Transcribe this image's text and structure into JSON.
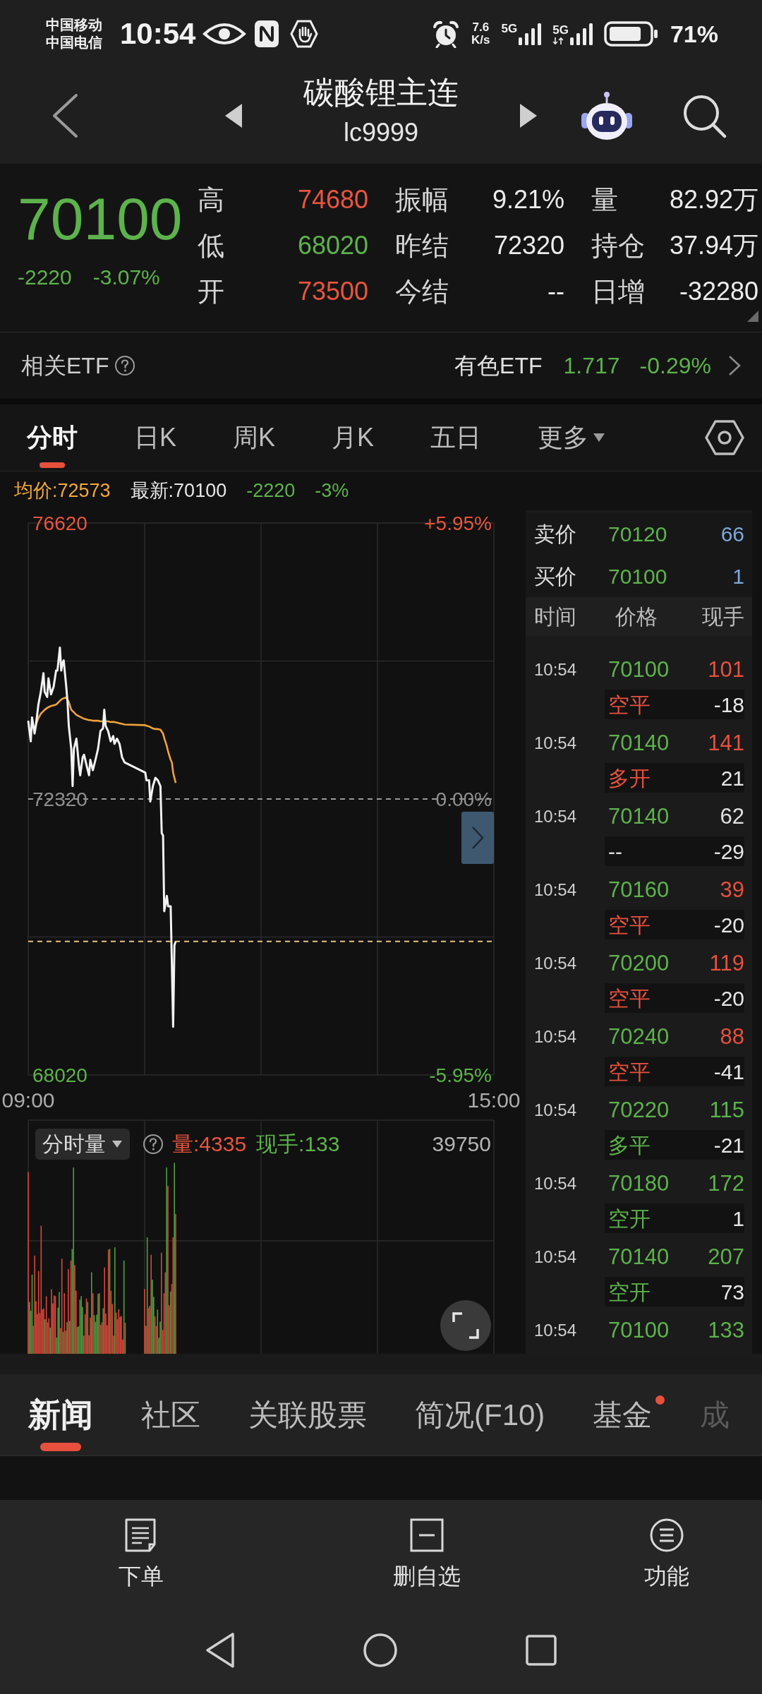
{
  "status_bar": {
    "carriers": [
      "中国移动",
      "中国电信"
    ],
    "time": "10:54",
    "speed": {
      "value": "7.6",
      "unit": "K/s"
    },
    "networks": [
      {
        "label": "5G",
        "kind": "plain"
      },
      {
        "label": "5G",
        "kind": "data"
      }
    ],
    "battery_text": "71%"
  },
  "header": {
    "title": "碳酸锂主连",
    "code": "lc9999"
  },
  "quote": {
    "price": "70100",
    "change": "-2220",
    "change_pct": "-3.07%",
    "stats": [
      {
        "label": "高",
        "value": "74680",
        "color": "#e8553f"
      },
      {
        "label": "振幅",
        "value": "9.21%"
      },
      {
        "label": "量",
        "value": "82.92万"
      },
      {
        "label": "低",
        "value": "68020",
        "color": "#5db24c"
      },
      {
        "label": "昨结",
        "value": "72320"
      },
      {
        "label": "持仓",
        "value": "37.94万"
      },
      {
        "label": "开",
        "value": "73500",
        "color": "#e8553f"
      },
      {
        "label": "今结",
        "value": "--"
      },
      {
        "label": "日增",
        "value": "-32280"
      }
    ]
  },
  "related_etf": {
    "label": "相关ETF",
    "name": "有色ETF",
    "price": "1.717",
    "change_pct": "-0.29%"
  },
  "chart_tabs": [
    {
      "label": "分时",
      "selected": true,
      "kind": "tab"
    },
    {
      "label": "日K",
      "selected": false,
      "kind": "tab"
    },
    {
      "label": "周K",
      "selected": false,
      "kind": "tab"
    },
    {
      "label": "月K",
      "selected": false,
      "kind": "tab"
    },
    {
      "label": "五日",
      "selected": false,
      "kind": "tab"
    },
    {
      "label": "更多",
      "selected": false,
      "kind": "menu"
    }
  ],
  "summary": {
    "average": "均价:72573",
    "latest": "最新:70100",
    "change": "-2220",
    "change_pct": "-3%"
  },
  "price_chart": {
    "chart_data": {
      "type": "line",
      "x": [
        9.0,
        9.033,
        9.049,
        9.082,
        9.098,
        9.131,
        9.163,
        9.196,
        9.212,
        9.245,
        9.261,
        9.294,
        9.327,
        9.359,
        9.376,
        9.408,
        9.425,
        9.441,
        9.457,
        9.49,
        9.506,
        9.523,
        9.555,
        9.572,
        9.588,
        9.621,
        9.653,
        9.67,
        9.702,
        9.719,
        9.751,
        9.784,
        9.8,
        9.833,
        9.866,
        9.899,
        9.931,
        9.964,
        9.98,
        9.997,
        10.029,
        10.062,
        10.095,
        10.111,
        10.144,
        10.176,
        10.209,
        10.242,
        10.508,
        10.524,
        10.557,
        10.573,
        10.606,
        10.639,
        10.671,
        10.704,
        10.72,
        10.737,
        10.753,
        10.786,
        10.802,
        10.835,
        10.851,
        10.867,
        10.884,
        10.9
      ],
      "series": [
        {
          "color": "#f2f2f2",
          "values": [
            73540,
            73220,
            73590,
            73340,
            73460,
            73790,
            73990,
            74280,
            73990,
            73910,
            74200,
            73950,
            74070,
            74320,
            74320,
            74680,
            74320,
            74440,
            74480,
            74070,
            73830,
            73460,
            73100,
            72520,
            73100,
            73260,
            72850,
            72690,
            72970,
            73010,
            72850,
            72690,
            72930,
            72770,
            72930,
            73100,
            73380,
            73420,
            73710,
            73460,
            73380,
            73220,
            73300,
            73180,
            73260,
            73180,
            72970,
            72890,
            72730,
            72610,
            72610,
            72280,
            72520,
            72650,
            72610,
            72520,
            71790,
            71750,
            70570,
            70810,
            70650,
            70650,
            69750,
            68770,
            70040,
            70100
          ]
        },
        {
          "color": "#f0a33a",
          "values": [
            null,
            null,
            null,
            73420,
            73470,
            73580,
            73650,
            73690,
            73710,
            73740,
            73750,
            73770,
            73780,
            73790,
            73810,
            73850,
            73870,
            73880,
            73890,
            73900,
            73870,
            73830,
            73710,
            73690,
            73670,
            73630,
            73610,
            73600,
            73580,
            73570,
            73560,
            73550,
            73550,
            73540,
            73540,
            73540,
            73530,
            73530,
            73530,
            73530,
            73530,
            73520,
            73520,
            73520,
            73510,
            73500,
            73490,
            73480,
            73470,
            73460,
            73450,
            73440,
            73420,
            73410,
            73410,
            73400,
            73370,
            73340,
            73270,
            73140,
            73060,
            72930,
            72890,
            72730,
            72650,
            72570
          ]
        }
      ],
      "xlim": [
        9,
        15
      ],
      "ylim": [
        68020,
        76620
      ],
      "xticks": [
        {
          "value": 9,
          "label": "09:00"
        },
        {
          "value": 15,
          "label": "15:00"
        }
      ],
      "yticks": [
        {
          "value": 76620,
          "label": "76620"
        },
        {
          "value": 72320,
          "label": "72320"
        },
        {
          "value": 68020,
          "label": "68020"
        }
      ],
      "ref_lines": [
        {
          "axis": "y",
          "value": 70100
        }
      ]
    },
    "right_labels": [
      "+5.95%",
      "0.00%",
      "-5.95%"
    ]
  },
  "volume_chart": {
    "selector": "分时量",
    "volume": "量:4335",
    "last_volume": "现手:133",
    "max": "39750"
  },
  "order_book": [
    {
      "label": "卖价",
      "price": "70120",
      "volume": "66"
    },
    {
      "label": "买价",
      "price": "70100",
      "volume": "1"
    }
  ],
  "trades": {
    "columns": [
      "时间",
      "价格",
      "现手"
    ],
    "rows": [
      {
        "time": "10:54",
        "price": "70100",
        "volume": "101",
        "type": "空平",
        "change": "-18",
        "color": "#e8503e"
      },
      {
        "time": "10:54",
        "price": "70140",
        "volume": "141",
        "type": "多开",
        "change": "21",
        "color": "#e8503e"
      },
      {
        "time": "10:54",
        "price": "70140",
        "volume": "62",
        "type": "--",
        "change": "-29",
        "color": "#e0e0e0"
      },
      {
        "time": "10:54",
        "price": "70160",
        "volume": "39",
        "type": "空平",
        "change": "-20",
        "color": "#e8503e"
      },
      {
        "time": "10:54",
        "price": "70200",
        "volume": "119",
        "type": "空平",
        "change": "-20",
        "color": "#e8503e"
      },
      {
        "time": "10:54",
        "price": "70240",
        "volume": "88",
        "type": "空平",
        "change": "-41",
        "color": "#e8503e"
      },
      {
        "time": "10:54",
        "price": "70220",
        "volume": "115",
        "type": "多平",
        "change": "-21",
        "color": "#5cb24a"
      },
      {
        "time": "10:54",
        "price": "70180",
        "volume": "172",
        "type": "空开",
        "change": "1",
        "color": "#5cb24a"
      },
      {
        "time": "10:54",
        "price": "70140",
        "volume": "207",
        "type": "空开",
        "change": "73",
        "color": "#5cb24a"
      },
      {
        "time": "10:54",
        "price": "70100",
        "volume": "133",
        "color": "#5cb24a"
      }
    ]
  },
  "news_tabs": [
    {
      "label": "新闻",
      "selected": true,
      "dot": false
    },
    {
      "label": "社区",
      "selected": false,
      "dot": false
    },
    {
      "label": "关联股票",
      "selected": false,
      "dot": false
    },
    {
      "label": "简况(F10)",
      "selected": false,
      "dot": false
    },
    {
      "label": "基金",
      "selected": false,
      "dot": true
    },
    {
      "label": "成",
      "selected": false,
      "dot": false
    }
  ],
  "actions": [
    {
      "label": "下单"
    },
    {
      "label": "删自选"
    },
    {
      "label": "功能"
    }
  ]
}
